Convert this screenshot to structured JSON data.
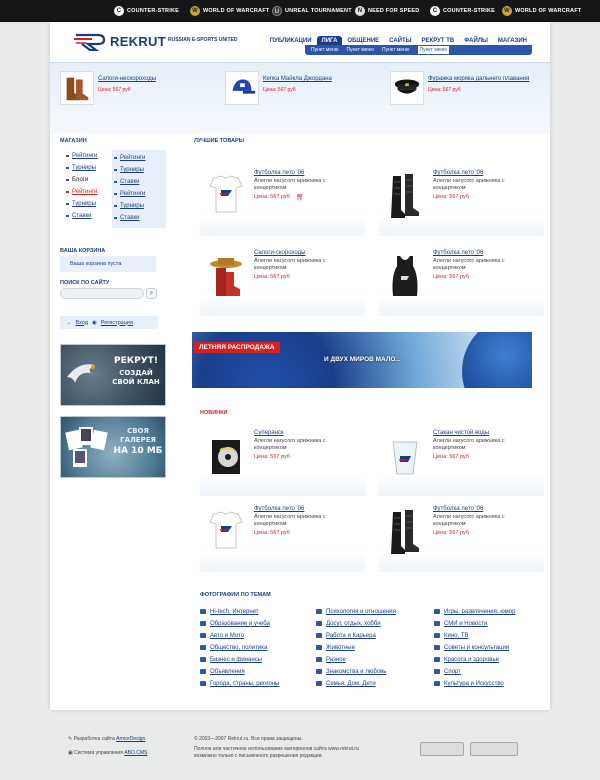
{
  "topbar": {
    "games": [
      {
        "label": "COUNTER-STRIKE",
        "icon": "counter-strike-icon",
        "glyph": "C"
      },
      {
        "label": "WORLD OF WARCRAFT",
        "icon": "warcraft-icon",
        "glyph": "W"
      },
      {
        "label": "UNREAL TOURNAMENT",
        "icon": "unreal-icon",
        "glyph": "U"
      },
      {
        "label": "NEED FOR SPEED",
        "icon": "nfs-icon",
        "glyph": "N"
      },
      {
        "label": "COUNTER-STRIKE",
        "icon": "counter-strike-icon",
        "glyph": "C"
      },
      {
        "label": "WORLD OF WARCRAFT",
        "icon": "warcraft-icon",
        "glyph": "W"
      }
    ]
  },
  "brand": {
    "name": "REKRUT",
    "tagline": "RUSSIAN E-SPORTS UNITED",
    "accent": "#1c3e88",
    "red": "#d32020"
  },
  "nav": {
    "tabs": [
      "ПУБЛИКАЦИИ",
      "ЛИГА",
      "ОБЩЕНИЕ",
      "САЙТЫ",
      "РЕКРУТ ТВ",
      "ФАЙЛЫ",
      "МАГАЗИН"
    ],
    "active": "ЛИГА",
    "sub": [
      "Пункт меню",
      "Пункт меню",
      "Пункт меню",
      "Пункт меню"
    ]
  },
  "promo": [
    {
      "name": "Сапоги-нескороходы",
      "price": "Цена: 567 руб"
    },
    {
      "name": "Кепка Майкла Джордана",
      "price": "Цена: 567 руб"
    },
    {
      "name": "Фуражка моряка дальнего плавания",
      "price": "Цена: 567 руб"
    }
  ],
  "shop": {
    "title": "МАГАЗИН",
    "col1": [
      "Рейтинги",
      "Турниры",
      "Блоги",
      "Рейтинги",
      "Турниры",
      "Ставки"
    ],
    "col2": [
      "Рейтинги",
      "Турниры",
      "Ставки",
      "Рейтинги",
      "Турниры",
      "Ставки"
    ]
  },
  "cart": {
    "title": "ВАША КОРЗИНА",
    "text": "Ваша корзина пуста"
  },
  "search": {
    "title": "ПОИСК ПО САЙТУ",
    "placeholder": ""
  },
  "auth": {
    "login": "Вход",
    "register": "Регистрация"
  },
  "banners": {
    "clan": {
      "line1": "РЕКРУТ!",
      "line2": "СОЗДАЙ",
      "line3": "СВОЙ КЛАН"
    },
    "gallery": {
      "line1": "СВОЯ",
      "line2": "ГАЛЕРЕЯ",
      "line3": "НА 10 МБ"
    }
  },
  "best": {
    "title": "ЛУЧШИЕ ТОВАРЫ",
    "items": [
      {
        "name": "Футболка лето '06",
        "desc": "Алегли нагусого арижника с концертиком",
        "price": "Цена: 567 руб"
      },
      {
        "name": "Футболка лето '06",
        "desc": "Алегли нагусого арижника с концертиком",
        "price": "Цена: 567 руб"
      },
      {
        "name": "Сапоги-скороходы",
        "desc": "Алегли нагусого арижника с концертиком",
        "price": "Цена: 567 руб"
      },
      {
        "name": "Футболка лето '06",
        "desc": "Алегли нагусого арижника с концертиком",
        "price": "Цена: 567 руб"
      }
    ]
  },
  "sale": {
    "tag": "ЛЕТНЯЯ РАСПРОДАЖА",
    "slogan": "И ДВУХ МИРОВ МАЛО..."
  },
  "news": {
    "title": "НОВИНКИ",
    "items": [
      {
        "name": "Суперанск",
        "desc": "Алегли нагусого арижника с концертиком",
        "price": "Цена: 567 руб"
      },
      {
        "name": "Стакан чистой воды",
        "desc": "Алегли нагусого арижника с концертиком",
        "price": "Цена: 567 руб"
      },
      {
        "name": "Футболка лето '06",
        "desc": "Алегли нагусого арижника с концертиком",
        "price": "Цена: 567 руб"
      },
      {
        "name": "Футболка лето '06",
        "desc": "Алегли нагусого арижника с концертиком",
        "price": "Цена: 567 руб"
      }
    ]
  },
  "photos": {
    "title": "ФОТОГРАФИИ ПО ТЕМАМ",
    "col1": [
      "Hi-tech, Интернет",
      "Образование и учеба",
      "Авто и Мото",
      "Общество, политика",
      "Бизнес и финансы",
      "Объявления",
      "Города, страны, регионы"
    ],
    "col2": [
      "Психология и отношения",
      "Досуг, отдых, хобби",
      "Работа и Карьера",
      "Животные",
      "Разное",
      "Знакомства и любовь",
      "Семья, Дом, Дети"
    ],
    "col3": [
      "Игры, развлечения, юмор",
      "СМИ и Новости",
      "Кино, ТВ",
      "Советы и консультации",
      "Красота и здоровье",
      "Спорт",
      "Культура и Искусство"
    ]
  },
  "footer": {
    "dev_prefix": "Разработка сайта",
    "dev_link": "ArmorDesign",
    "cms_prefix": "Система управления",
    "cms_link": "ABO.CMS",
    "copyright": "© 2003—2007 Rekrut.ru. Все права защищены.",
    "notice1": "Полное или частичное использование материалов сайта www.rekrut.ru",
    "notice2": "возможно только с письменного разрешения редакции."
  }
}
